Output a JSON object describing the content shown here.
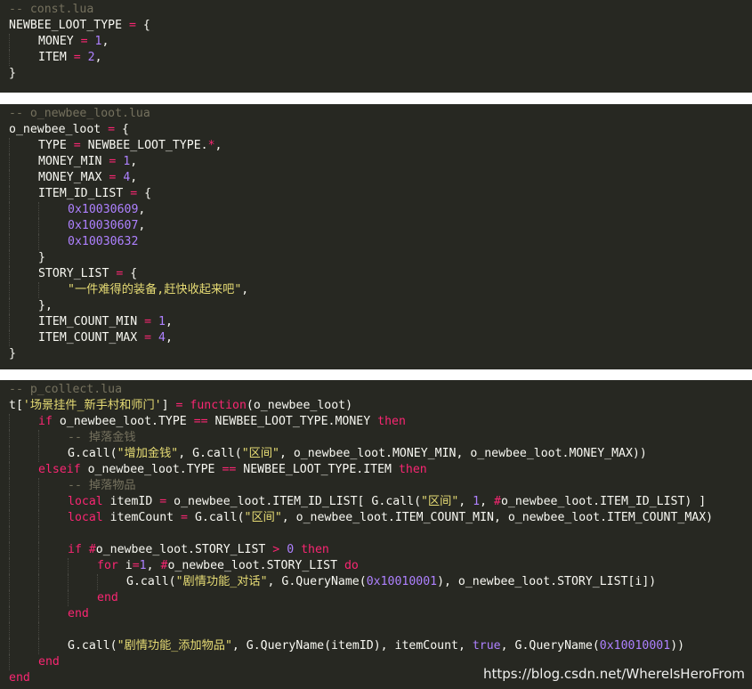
{
  "colors": {
    "background": "#272822",
    "comment": "#75715e",
    "keyword": "#f92672",
    "number": "#ae81ff",
    "string": "#e6db74",
    "text": "#f8f8f2"
  },
  "panels": [
    {
      "lines": [
        {
          "indent": 0,
          "tokens": [
            {
              "t": "-- const.lua",
              "c": "com"
            }
          ]
        },
        {
          "indent": 0,
          "tokens": [
            {
              "t": "NEWBEE_LOOT_TYPE ",
              "c": "id"
            },
            {
              "t": "=",
              "c": "op"
            },
            {
              "t": " {",
              "c": "id"
            }
          ]
        },
        {
          "indent": 1,
          "tokens": [
            {
              "t": "MONEY ",
              "c": "id"
            },
            {
              "t": "=",
              "c": "op"
            },
            {
              "t": " ",
              "c": "id"
            },
            {
              "t": "1",
              "c": "num"
            },
            {
              "t": ",",
              "c": "id"
            }
          ]
        },
        {
          "indent": 1,
          "tokens": [
            {
              "t": "ITEM ",
              "c": "id"
            },
            {
              "t": "=",
              "c": "op"
            },
            {
              "t": " ",
              "c": "id"
            },
            {
              "t": "2",
              "c": "num"
            },
            {
              "t": ",",
              "c": "id"
            }
          ]
        },
        {
          "indent": 0,
          "tokens": [
            {
              "t": "}",
              "c": "id"
            }
          ]
        }
      ]
    },
    {
      "lines": [
        {
          "indent": 0,
          "tokens": [
            {
              "t": "-- o_newbee_loot.lua",
              "c": "com"
            }
          ]
        },
        {
          "indent": 0,
          "tokens": [
            {
              "t": "o_newbee_loot ",
              "c": "id"
            },
            {
              "t": "=",
              "c": "op"
            },
            {
              "t": " {",
              "c": "id"
            }
          ]
        },
        {
          "indent": 1,
          "tokens": [
            {
              "t": "TYPE ",
              "c": "id"
            },
            {
              "t": "=",
              "c": "op"
            },
            {
              "t": " NEWBEE_LOOT_TYPE.",
              "c": "id"
            },
            {
              "t": "*",
              "c": "op"
            },
            {
              "t": ",",
              "c": "id"
            }
          ]
        },
        {
          "indent": 1,
          "tokens": [
            {
              "t": "MONEY_MIN ",
              "c": "id"
            },
            {
              "t": "=",
              "c": "op"
            },
            {
              "t": " ",
              "c": "id"
            },
            {
              "t": "1",
              "c": "num"
            },
            {
              "t": ",",
              "c": "id"
            }
          ]
        },
        {
          "indent": 1,
          "tokens": [
            {
              "t": "MONEY_MAX ",
              "c": "id"
            },
            {
              "t": "=",
              "c": "op"
            },
            {
              "t": " ",
              "c": "id"
            },
            {
              "t": "4",
              "c": "num"
            },
            {
              "t": ",",
              "c": "id"
            }
          ]
        },
        {
          "indent": 1,
          "tokens": [
            {
              "t": "ITEM_ID_LIST ",
              "c": "id"
            },
            {
              "t": "=",
              "c": "op"
            },
            {
              "t": " {",
              "c": "id"
            }
          ]
        },
        {
          "indent": 2,
          "tokens": [
            {
              "t": "0x10030609",
              "c": "num"
            },
            {
              "t": ",",
              "c": "id"
            }
          ]
        },
        {
          "indent": 2,
          "tokens": [
            {
              "t": "0x10030607",
              "c": "num"
            },
            {
              "t": ",",
              "c": "id"
            }
          ]
        },
        {
          "indent": 2,
          "tokens": [
            {
              "t": "0x10030632",
              "c": "num"
            }
          ]
        },
        {
          "indent": 1,
          "tokens": [
            {
              "t": "}",
              "c": "id"
            }
          ]
        },
        {
          "indent": 1,
          "tokens": [
            {
              "t": "STORY_LIST ",
              "c": "id"
            },
            {
              "t": "=",
              "c": "op"
            },
            {
              "t": " {",
              "c": "id"
            }
          ]
        },
        {
          "indent": 2,
          "tokens": [
            {
              "t": "\"一件难得的装备,赶快收起来吧\"",
              "c": "str"
            },
            {
              "t": ",",
              "c": "id"
            }
          ]
        },
        {
          "indent": 1,
          "tokens": [
            {
              "t": "},",
              "c": "id"
            }
          ]
        },
        {
          "indent": 1,
          "tokens": [
            {
              "t": "ITEM_COUNT_MIN ",
              "c": "id"
            },
            {
              "t": "=",
              "c": "op"
            },
            {
              "t": " ",
              "c": "id"
            },
            {
              "t": "1",
              "c": "num"
            },
            {
              "t": ",",
              "c": "id"
            }
          ]
        },
        {
          "indent": 1,
          "tokens": [
            {
              "t": "ITEM_COUNT_MAX ",
              "c": "id"
            },
            {
              "t": "=",
              "c": "op"
            },
            {
              "t": " ",
              "c": "id"
            },
            {
              "t": "4",
              "c": "num"
            },
            {
              "t": ",",
              "c": "id"
            }
          ]
        },
        {
          "indent": 0,
          "tokens": [
            {
              "t": "}",
              "c": "id"
            }
          ]
        }
      ]
    },
    {
      "lines": [
        {
          "indent": 0,
          "tokens": [
            {
              "t": "-- p_collect.lua",
              "c": "com"
            }
          ]
        },
        {
          "indent": 0,
          "tokens": [
            {
              "t": "t[",
              "c": "id"
            },
            {
              "t": "'场景挂件_新手村和师门'",
              "c": "str"
            },
            {
              "t": "] ",
              "c": "id"
            },
            {
              "t": "=",
              "c": "op"
            },
            {
              "t": " ",
              "c": "id"
            },
            {
              "t": "function",
              "c": "op"
            },
            {
              "t": "(o_newbee_loot)",
              "c": "id"
            }
          ]
        },
        {
          "indent": 1,
          "tokens": [
            {
              "t": "if",
              "c": "op"
            },
            {
              "t": " o_newbee_loot.TYPE ",
              "c": "id"
            },
            {
              "t": "==",
              "c": "op"
            },
            {
              "t": " NEWBEE_LOOT_TYPE.MONEY ",
              "c": "id"
            },
            {
              "t": "then",
              "c": "op"
            }
          ]
        },
        {
          "indent": 2,
          "tokens": [
            {
              "t": "-- 掉落金钱",
              "c": "com"
            }
          ]
        },
        {
          "indent": 2,
          "tokens": [
            {
              "t": "G.call(",
              "c": "id"
            },
            {
              "t": "\"增加金钱\"",
              "c": "str"
            },
            {
              "t": ", G.call(",
              "c": "id"
            },
            {
              "t": "\"区间\"",
              "c": "str"
            },
            {
              "t": ", o_newbee_loot.MONEY_MIN, o_newbee_loot.MONEY_MAX))",
              "c": "id"
            }
          ]
        },
        {
          "indent": 1,
          "tokens": [
            {
              "t": "elseif",
              "c": "op"
            },
            {
              "t": " o_newbee_loot.TYPE ",
              "c": "id"
            },
            {
              "t": "==",
              "c": "op"
            },
            {
              "t": " NEWBEE_LOOT_TYPE.ITEM ",
              "c": "id"
            },
            {
              "t": "then",
              "c": "op"
            }
          ]
        },
        {
          "indent": 2,
          "tokens": [
            {
              "t": "-- 掉落物品",
              "c": "com"
            }
          ]
        },
        {
          "indent": 2,
          "tokens": [
            {
              "t": "local",
              "c": "op"
            },
            {
              "t": " itemID ",
              "c": "id"
            },
            {
              "t": "=",
              "c": "op"
            },
            {
              "t": " o_newbee_loot.ITEM_ID_LIST[ G.call(",
              "c": "id"
            },
            {
              "t": "\"区间\"",
              "c": "str"
            },
            {
              "t": ", ",
              "c": "id"
            },
            {
              "t": "1",
              "c": "num"
            },
            {
              "t": ", ",
              "c": "id"
            },
            {
              "t": "#",
              "c": "op"
            },
            {
              "t": "o_newbee_loot.ITEM_ID_LIST) ]",
              "c": "id"
            }
          ]
        },
        {
          "indent": 2,
          "tokens": [
            {
              "t": "local",
              "c": "op"
            },
            {
              "t": " itemCount ",
              "c": "id"
            },
            {
              "t": "=",
              "c": "op"
            },
            {
              "t": " G.call(",
              "c": "id"
            },
            {
              "t": "\"区间\"",
              "c": "str"
            },
            {
              "t": ", o_newbee_loot.ITEM_COUNT_MIN, o_newbee_loot.ITEM_COUNT_MAX)",
              "c": "id"
            }
          ]
        },
        {
          "indent": 2,
          "tokens": []
        },
        {
          "indent": 2,
          "tokens": [
            {
              "t": "if",
              "c": "op"
            },
            {
              "t": " ",
              "c": "id"
            },
            {
              "t": "#",
              "c": "op"
            },
            {
              "t": "o_newbee_loot.STORY_LIST ",
              "c": "id"
            },
            {
              "t": ">",
              "c": "op"
            },
            {
              "t": " ",
              "c": "id"
            },
            {
              "t": "0",
              "c": "num"
            },
            {
              "t": " ",
              "c": "id"
            },
            {
              "t": "then",
              "c": "op"
            }
          ]
        },
        {
          "indent": 3,
          "tokens": [
            {
              "t": "for",
              "c": "op"
            },
            {
              "t": " i",
              "c": "id"
            },
            {
              "t": "=",
              "c": "op"
            },
            {
              "t": "1",
              "c": "num"
            },
            {
              "t": ", ",
              "c": "id"
            },
            {
              "t": "#",
              "c": "op"
            },
            {
              "t": "o_newbee_loot.STORY_LIST ",
              "c": "id"
            },
            {
              "t": "do",
              "c": "op"
            }
          ]
        },
        {
          "indent": 4,
          "tokens": [
            {
              "t": "G.call(",
              "c": "id"
            },
            {
              "t": "\"剧情功能_对话\"",
              "c": "str"
            },
            {
              "t": ", G.QueryName(",
              "c": "id"
            },
            {
              "t": "0x10010001",
              "c": "num"
            },
            {
              "t": "), o_newbee_loot.STORY_LIST[i])",
              "c": "id"
            }
          ]
        },
        {
          "indent": 3,
          "tokens": [
            {
              "t": "end",
              "c": "op"
            }
          ]
        },
        {
          "indent": 2,
          "tokens": [
            {
              "t": "end",
              "c": "op"
            }
          ]
        },
        {
          "indent": 2,
          "tokens": []
        },
        {
          "indent": 2,
          "tokens": [
            {
              "t": "G.call(",
              "c": "id"
            },
            {
              "t": "\"剧情功能_添加物品\"",
              "c": "str"
            },
            {
              "t": ", G.QueryName(itemID), itemCount, ",
              "c": "id"
            },
            {
              "t": "true",
              "c": "num"
            },
            {
              "t": ", G.QueryName(",
              "c": "id"
            },
            {
              "t": "0x10010001",
              "c": "num"
            },
            {
              "t": "))",
              "c": "id"
            }
          ]
        },
        {
          "indent": 1,
          "tokens": [
            {
              "t": "end",
              "c": "op"
            }
          ]
        },
        {
          "indent": 0,
          "tokens": [
            {
              "t": "end",
              "c": "op"
            }
          ]
        }
      ]
    }
  ],
  "watermark": "https://blog.csdn.net/WhereIsHeroFrom"
}
